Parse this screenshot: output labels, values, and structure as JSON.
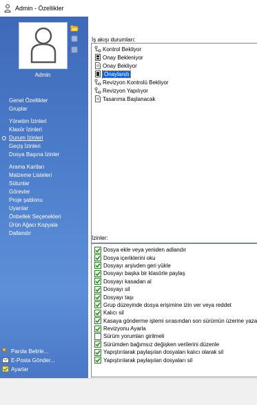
{
  "window": {
    "title": "Admin - Özellikler",
    "icon": "user-icon"
  },
  "profile": {
    "name": "Admin",
    "avatar_icon": "person-silhouette-icon"
  },
  "tools": [
    "folder-open-icon",
    "delete-icon",
    "properties-icon"
  ],
  "nav": {
    "groups": [
      [
        {
          "label": "Genel Özellikler"
        },
        {
          "label": "Gruplar"
        }
      ],
      [
        {
          "label": "Yönetim İzinleri"
        },
        {
          "label": "Klasör İzinleri"
        },
        {
          "label": "Durum İzinleri",
          "active": true
        },
        {
          "label": "Geçiş İzinleri"
        },
        {
          "label": "Dosya Başına İzinler"
        }
      ],
      [
        {
          "label": "Arama Kartları"
        },
        {
          "label": "Malzeme Listeleri"
        },
        {
          "label": "Sütunlar"
        },
        {
          "label": "Görevler"
        },
        {
          "label": "Proje şablonu"
        },
        {
          "label": "Uyarılar"
        },
        {
          "label": "Önbellek Seçenekleri"
        },
        {
          "label": "Ürün Ağacı Kopyala"
        },
        {
          "label": "Dallandır"
        }
      ]
    ]
  },
  "bottom_links": [
    {
      "label": "Parola Belirle...",
      "icon": "key-icon"
    },
    {
      "label": "E-Posta Gönder...",
      "icon": "envelope-icon"
    },
    {
      "label": "Ayarlar",
      "icon": "settings-icon"
    }
  ],
  "workflow": {
    "label": "İş akışı durumları:",
    "states": [
      {
        "label": "Kontrol Bekliyor",
        "icon": "workflow-state-icon"
      },
      {
        "label": "Onay Bekleniyor",
        "icon": "approval-state-icon"
      },
      {
        "label": "Onay Bekliyor",
        "icon": "document-state-icon"
      },
      {
        "label": "Onaylandı",
        "icon": "approved-state-icon",
        "selected": true
      },
      {
        "label": "Revizyon Kontrolü Bekliyor",
        "icon": "workflow-state-icon"
      },
      {
        "label": "Revizyon Yapılıyor",
        "icon": "workflow-state-icon"
      },
      {
        "label": "Tasarıma Başlanacak",
        "icon": "document-state-icon"
      }
    ]
  },
  "permissions": {
    "label": "İzinler:",
    "items": [
      {
        "label": "Dosya ekle veya yeniden adlandır",
        "checked": true
      },
      {
        "label": "Dosya içeriklerini oku",
        "checked": true
      },
      {
        "label": "Dosyayı arşivden geri yükle",
        "checked": true
      },
      {
        "label": "Dosyayı başka bir klasörle paylaş",
        "checked": true
      },
      {
        "label": "Dosyayı kasadan al",
        "checked": true
      },
      {
        "label": "Dosyayı sil",
        "checked": true
      },
      {
        "label": "Dosyayı taşı",
        "checked": true
      },
      {
        "label": "Grup düzeyinde dosya erişimine izin ver veya reddet",
        "checked": true
      },
      {
        "label": "Kalıcı sil",
        "checked": true
      },
      {
        "label": "Kasaya gönderme işlemi sırasından son sürümün üzerine yazabilir",
        "checked": true
      },
      {
        "label": "Revizyonu Ayarla",
        "checked": true
      },
      {
        "label": "Sürüm yorumları girilmeli",
        "checked": false
      },
      {
        "label": "Sürümden bağımsız değişken verilerini düzenle",
        "checked": true
      },
      {
        "label": "Yapıştırılarak paylaşılan dosyaları kalıcı olarak sil",
        "checked": true
      },
      {
        "label": "Yapıştırılarak paylaşılan dosyaları sil",
        "checked": true
      }
    ]
  },
  "colors": {
    "sidebar_top": "#3e69b8",
    "sidebar_bottom": "#4a77c6",
    "selection": "#0a64d6",
    "check": "#1f8a1f"
  }
}
